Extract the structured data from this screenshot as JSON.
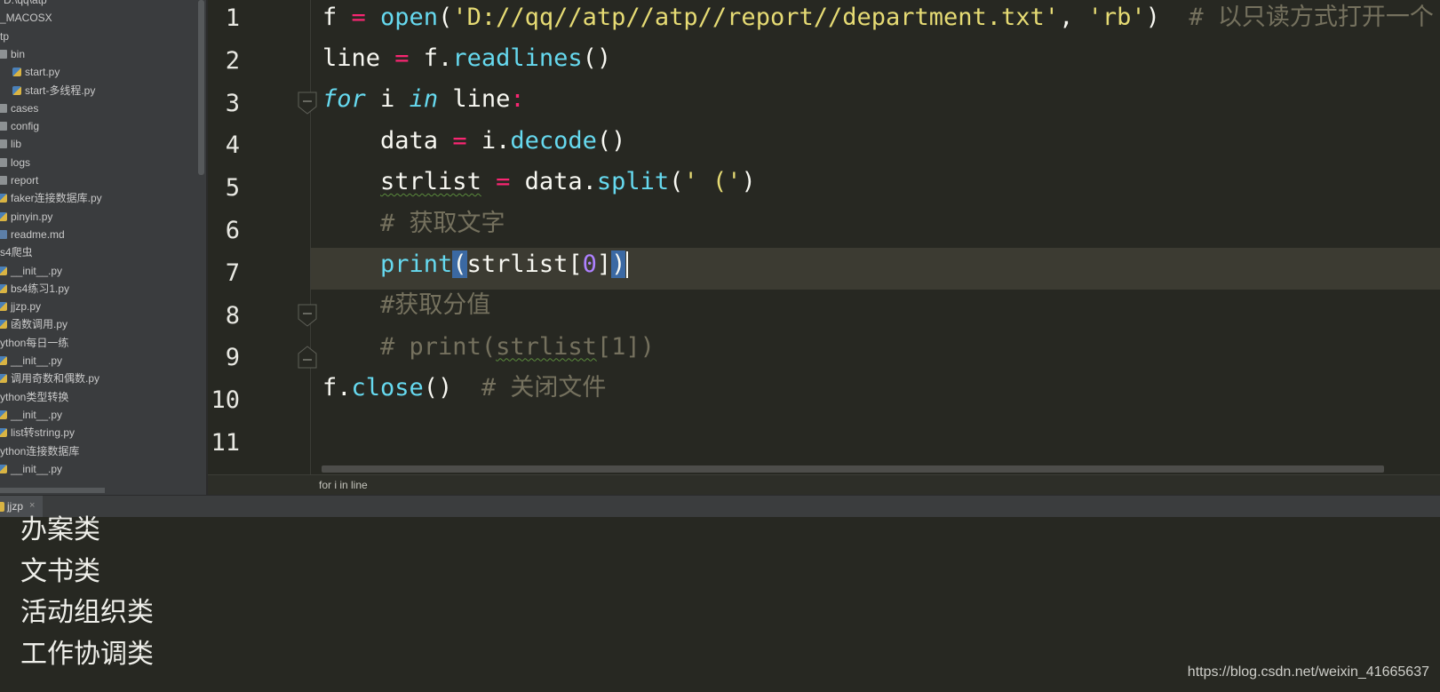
{
  "sidebar": {
    "items": [
      {
        "label": "D:\\qq\\atp",
        "icon": "none",
        "indent": 1
      },
      {
        "label": "_MACOSX",
        "icon": "none",
        "indent": 0
      },
      {
        "label": "tp",
        "icon": "none",
        "indent": 0
      },
      {
        "label": "bin",
        "icon": "folder-icon",
        "indent": 0
      },
      {
        "label": "start.py",
        "icon": "python-file-icon",
        "indent": 1
      },
      {
        "label": "start-多线程.py",
        "icon": "python-file-icon",
        "indent": 1
      },
      {
        "label": "cases",
        "icon": "folder-icon",
        "indent": 0
      },
      {
        "label": "config",
        "icon": "folder-icon",
        "indent": 0
      },
      {
        "label": "lib",
        "icon": "folder-icon",
        "indent": 0
      },
      {
        "label": "logs",
        "icon": "folder-icon",
        "indent": 0
      },
      {
        "label": "report",
        "icon": "folder-icon",
        "indent": 0
      },
      {
        "label": "faker连接数据库.py",
        "icon": "python-file-icon",
        "indent": 0
      },
      {
        "label": "pinyin.py",
        "icon": "python-file-icon",
        "indent": 0
      },
      {
        "label": "readme.md",
        "icon": "markdown-file-icon",
        "indent": 0
      },
      {
        "label": "s4爬虫",
        "icon": "none",
        "indent": 0
      },
      {
        "label": "__init__.py",
        "icon": "python-file-icon",
        "indent": 0
      },
      {
        "label": "bs4练习1.py",
        "icon": "python-file-icon",
        "indent": 0
      },
      {
        "label": "jjzp.py",
        "icon": "python-file-icon",
        "indent": 0
      },
      {
        "label": "函数调用.py",
        "icon": "python-file-icon",
        "indent": 0
      },
      {
        "label": "ython每日一练",
        "icon": "none",
        "indent": 0
      },
      {
        "label": "__init__.py",
        "icon": "python-file-icon",
        "indent": 0
      },
      {
        "label": "调用奇数和偶数.py",
        "icon": "python-file-icon",
        "indent": 0
      },
      {
        "label": "ython类型转换",
        "icon": "none",
        "indent": 0
      },
      {
        "label": "__init__.py",
        "icon": "python-file-icon",
        "indent": 0
      },
      {
        "label": "list转string.py",
        "icon": "python-file-icon",
        "indent": 0
      },
      {
        "label": "ython连接数据库",
        "icon": "none",
        "indent": 0
      },
      {
        "label": "__init__.py",
        "icon": "python-file-icon",
        "indent": 0
      }
    ]
  },
  "editor": {
    "line_numbers": [
      "1",
      "2",
      "3",
      "4",
      "5",
      "6",
      "7",
      "8",
      "9",
      "10",
      "11"
    ],
    "current_line": 7,
    "code": [
      [
        [
          "f ",
          ""
        ],
        [
          "= ",
          "op"
        ],
        [
          "open",
          "fn"
        ],
        [
          "(",
          ""
        ],
        [
          "'D://qq//atp//atp//report//department.txt'",
          "str"
        ],
        [
          ", ",
          ""
        ],
        [
          "'rb'",
          "str"
        ],
        [
          ")  ",
          ""
        ],
        [
          "# 以只读方式打开一个",
          "cm"
        ]
      ],
      [
        [
          "line ",
          ""
        ],
        [
          "= ",
          "op"
        ],
        [
          "f.",
          ""
        ],
        [
          "readlines",
          "fn"
        ],
        [
          "()",
          ""
        ]
      ],
      [
        [
          "for",
          "kw"
        ],
        [
          " i ",
          ""
        ],
        [
          "in",
          "kw"
        ],
        [
          " line",
          ""
        ],
        [
          ":",
          "op"
        ]
      ],
      [
        [
          "    data ",
          ""
        ],
        [
          "= ",
          "op"
        ],
        [
          "i.",
          ""
        ],
        [
          "decode",
          "fn"
        ],
        [
          "()",
          ""
        ]
      ],
      [
        [
          "    ",
          ""
        ],
        [
          "strlist",
          "squiggle"
        ],
        [
          " ",
          ""
        ],
        [
          "= ",
          "op"
        ],
        [
          "data.",
          ""
        ],
        [
          "split",
          "fn"
        ],
        [
          "(",
          ""
        ],
        [
          "' ('",
          "str"
        ],
        [
          ")",
          ""
        ]
      ],
      [
        [
          "    ",
          ""
        ],
        [
          "# 获取文字",
          "cm"
        ]
      ],
      [
        [
          "    ",
          ""
        ],
        [
          "print",
          "fn"
        ],
        [
          "(",
          "brace-hl"
        ],
        [
          "strlist[",
          ""
        ],
        [
          "0",
          "num"
        ],
        [
          "]",
          ""
        ],
        [
          ")",
          "brace-hl"
        ],
        [
          "",
          "caret"
        ]
      ],
      [
        [
          "    ",
          ""
        ],
        [
          "#获取分值",
          "cm"
        ]
      ],
      [
        [
          "    ",
          ""
        ],
        [
          "# print(",
          "cm"
        ],
        [
          "strlist",
          "cm-squiggle"
        ],
        [
          "[1])",
          "cm"
        ]
      ],
      [
        [
          "f.",
          ""
        ],
        [
          "close",
          "fn"
        ],
        [
          "()  ",
          ""
        ],
        [
          "# 关闭文件",
          "cm"
        ]
      ],
      []
    ],
    "breadcrumb": "for i in line"
  },
  "run_panel": {
    "tab_label": "jjzp",
    "tab_close": "×",
    "output": [
      "办案类",
      "文书类",
      "活动组织类",
      "工作协调类"
    ]
  },
  "watermark": "https://blog.csdn.net/weixin_41665637",
  "colors": {
    "background": "#272822",
    "keyword": "#66d9ef",
    "operator": "#f92672",
    "string": "#e6db74",
    "number": "#ae81ff",
    "comment": "#75715e",
    "current_line": "#3c3b32",
    "brace_match": "#3b69a3"
  }
}
